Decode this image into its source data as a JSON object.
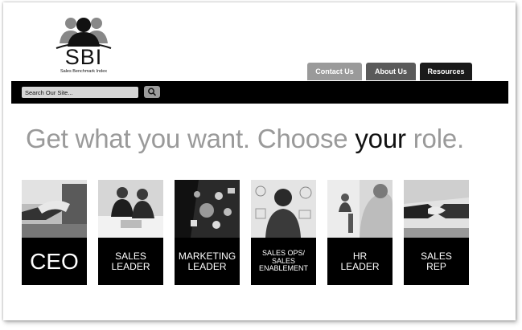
{
  "logo": {
    "text": "SBI",
    "subtitle": "Sales Benchmark Index"
  },
  "nav": {
    "tabs": [
      {
        "label": "Contact Us"
      },
      {
        "label": "About Us"
      },
      {
        "label": "Resources"
      }
    ]
  },
  "search": {
    "placeholder": "Search Our Site...",
    "button_icon": "search-icon"
  },
  "headline": {
    "part1": "Get what you want. Choose ",
    "emphasis": "your",
    "part2": " role."
  },
  "roles": [
    {
      "line1": "CEO",
      "line2": "",
      "line3": "",
      "photo": "handshake-photo"
    },
    {
      "line1": "SALES",
      "line2": "LEADER",
      "line3": "",
      "photo": "meeting-photo"
    },
    {
      "line1": "MARKETING",
      "line2": "LEADER",
      "line3": "",
      "photo": "digital-icons-photo"
    },
    {
      "line1": "SALES OPS/",
      "line2": "SALES",
      "line3": "ENABLEMENT",
      "photo": "whiteboard-photo"
    },
    {
      "line1": "HR",
      "line2": "LEADER",
      "line3": "",
      "photo": "candidate-photo"
    },
    {
      "line1": "SALES",
      "line2": "REP",
      "line3": "",
      "photo": "handshake-photo"
    }
  ],
  "colors": {
    "bar": "#000000",
    "headline": "#9a9a9a",
    "emphasis": "#111111"
  }
}
